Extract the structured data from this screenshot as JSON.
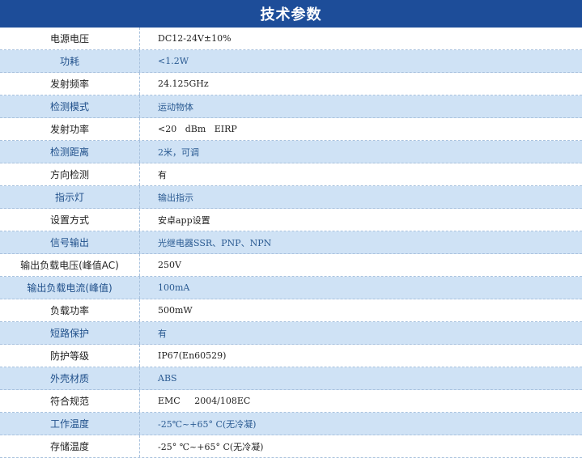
{
  "title": "技术参数",
  "rows": [
    {
      "label": "电源电压",
      "value": "DC12-24V±10%"
    },
    {
      "label": "功耗",
      "value": "<1.2W"
    },
    {
      "label": "发射频率",
      "value": "24.125GHz"
    },
    {
      "label": "检测模式",
      "value": "运动物体"
    },
    {
      "label": "发射功率",
      "value": "<20   dBm   EIRP"
    },
    {
      "label": "检测距离",
      "value": "2米，可调"
    },
    {
      "label": "方向检测",
      "value": "有"
    },
    {
      "label": "指示灯",
      "value": "输出指示"
    },
    {
      "label": "设置方式",
      "value": "安卓app设置"
    },
    {
      "label": "信号输出",
      "value": "光继电器SSR、PNP、NPN"
    },
    {
      "label": "输出负载电压(峰值AC)",
      "value": "250V"
    },
    {
      "label": "输出负载电流(峰值)",
      "value": "100mA"
    },
    {
      "label": "负载功率",
      "value": "500mW"
    },
    {
      "label": "短路保护",
      "value": "有"
    },
    {
      "label": "防护等级",
      "value": "IP67(En60529)"
    },
    {
      "label": "外壳材质",
      "value": "ABS"
    },
    {
      "label": "符合规范",
      "value": "EMC     2004/108EC"
    },
    {
      "label": "工作温度",
      "value": "-25℃~+65° C(无冷凝)"
    },
    {
      "label": "存储温度",
      "value": "-25° ℃~+65° C(无冷凝)"
    }
  ]
}
